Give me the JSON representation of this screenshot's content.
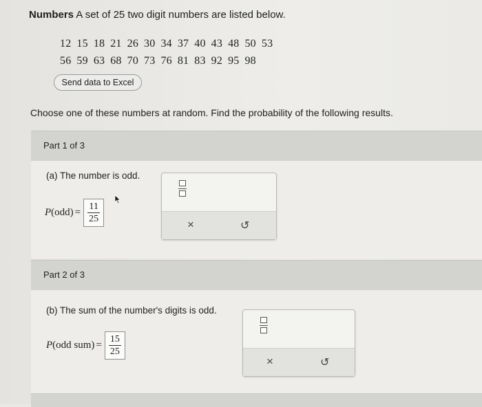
{
  "problem": {
    "title_bold": "Numbers",
    "title_rest": " A set of 25 two digit numbers are listed below.",
    "row1": [
      "12",
      "15",
      "18",
      "21",
      "26",
      "30",
      "34",
      "37",
      "40",
      "43",
      "48",
      "50",
      "53"
    ],
    "row2": [
      "56",
      "59",
      "63",
      "68",
      "70",
      "73",
      "76",
      "81",
      "83",
      "92",
      "95",
      "98"
    ],
    "excel_button": "Send data to Excel",
    "instruction": "Choose one of these numbers at random. Find the probability of the following results."
  },
  "parts": [
    {
      "header": "Part 1 of 3",
      "question": "(a) The number is odd.",
      "expr_italic": "P",
      "expr_arg": "(odd)",
      "equals": "=",
      "numerator": "11",
      "denominator": "25"
    },
    {
      "header": "Part 2 of 3",
      "question": "(b) The sum of the number's digits is odd.",
      "expr_italic": "P",
      "expr_arg": "(odd sum)",
      "equals": "=",
      "numerator": "15",
      "denominator": "25"
    }
  ],
  "tool": {
    "clear_symbol": "×",
    "undo_symbol": "↺",
    "fraction_icon": "fraction-template-icon"
  }
}
